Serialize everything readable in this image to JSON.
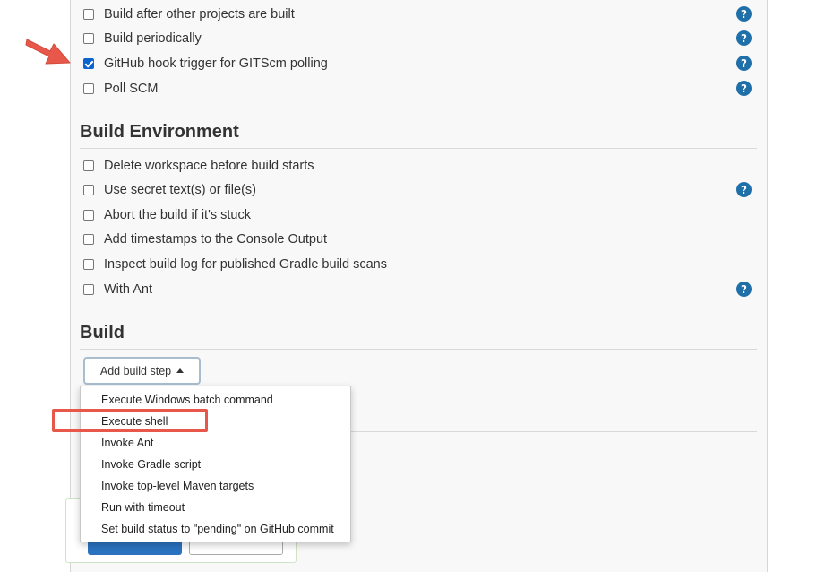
{
  "triggers": [
    {
      "label": "Build after other projects are built",
      "checked": false,
      "help": true
    },
    {
      "label": "Build periodically",
      "checked": false,
      "help": true
    },
    {
      "label": "GitHub hook trigger for GITScm polling",
      "checked": true,
      "help": true
    },
    {
      "label": "Poll SCM",
      "checked": false,
      "help": true
    }
  ],
  "build_environment": {
    "title": "Build Environment",
    "options": [
      {
        "label": "Delete workspace before build starts",
        "checked": false,
        "help": false
      },
      {
        "label": "Use secret text(s) or file(s)",
        "checked": false,
        "help": true
      },
      {
        "label": "Abort the build if it's stuck",
        "checked": false,
        "help": false
      },
      {
        "label": "Add timestamps to the Console Output",
        "checked": false,
        "help": false
      },
      {
        "label": "Inspect build log for published Gradle build scans",
        "checked": false,
        "help": false
      },
      {
        "label": "With Ant",
        "checked": false,
        "help": true
      }
    ]
  },
  "build": {
    "title": "Build",
    "add_step_label": "Add build step",
    "menu_items": [
      "Execute Windows batch command",
      "Execute shell",
      "Invoke Ant",
      "Invoke Gradle script",
      "Invoke top-level Maven targets",
      "Run with timeout",
      "Set build status to \"pending\" on GitHub commit"
    ],
    "highlighted_item": "Execute shell"
  },
  "help_glyph": "?",
  "colors": {
    "checkbox_checked": "#0b63ce",
    "help_icon": "#1f6fa8",
    "annotation": "#e8584a"
  }
}
